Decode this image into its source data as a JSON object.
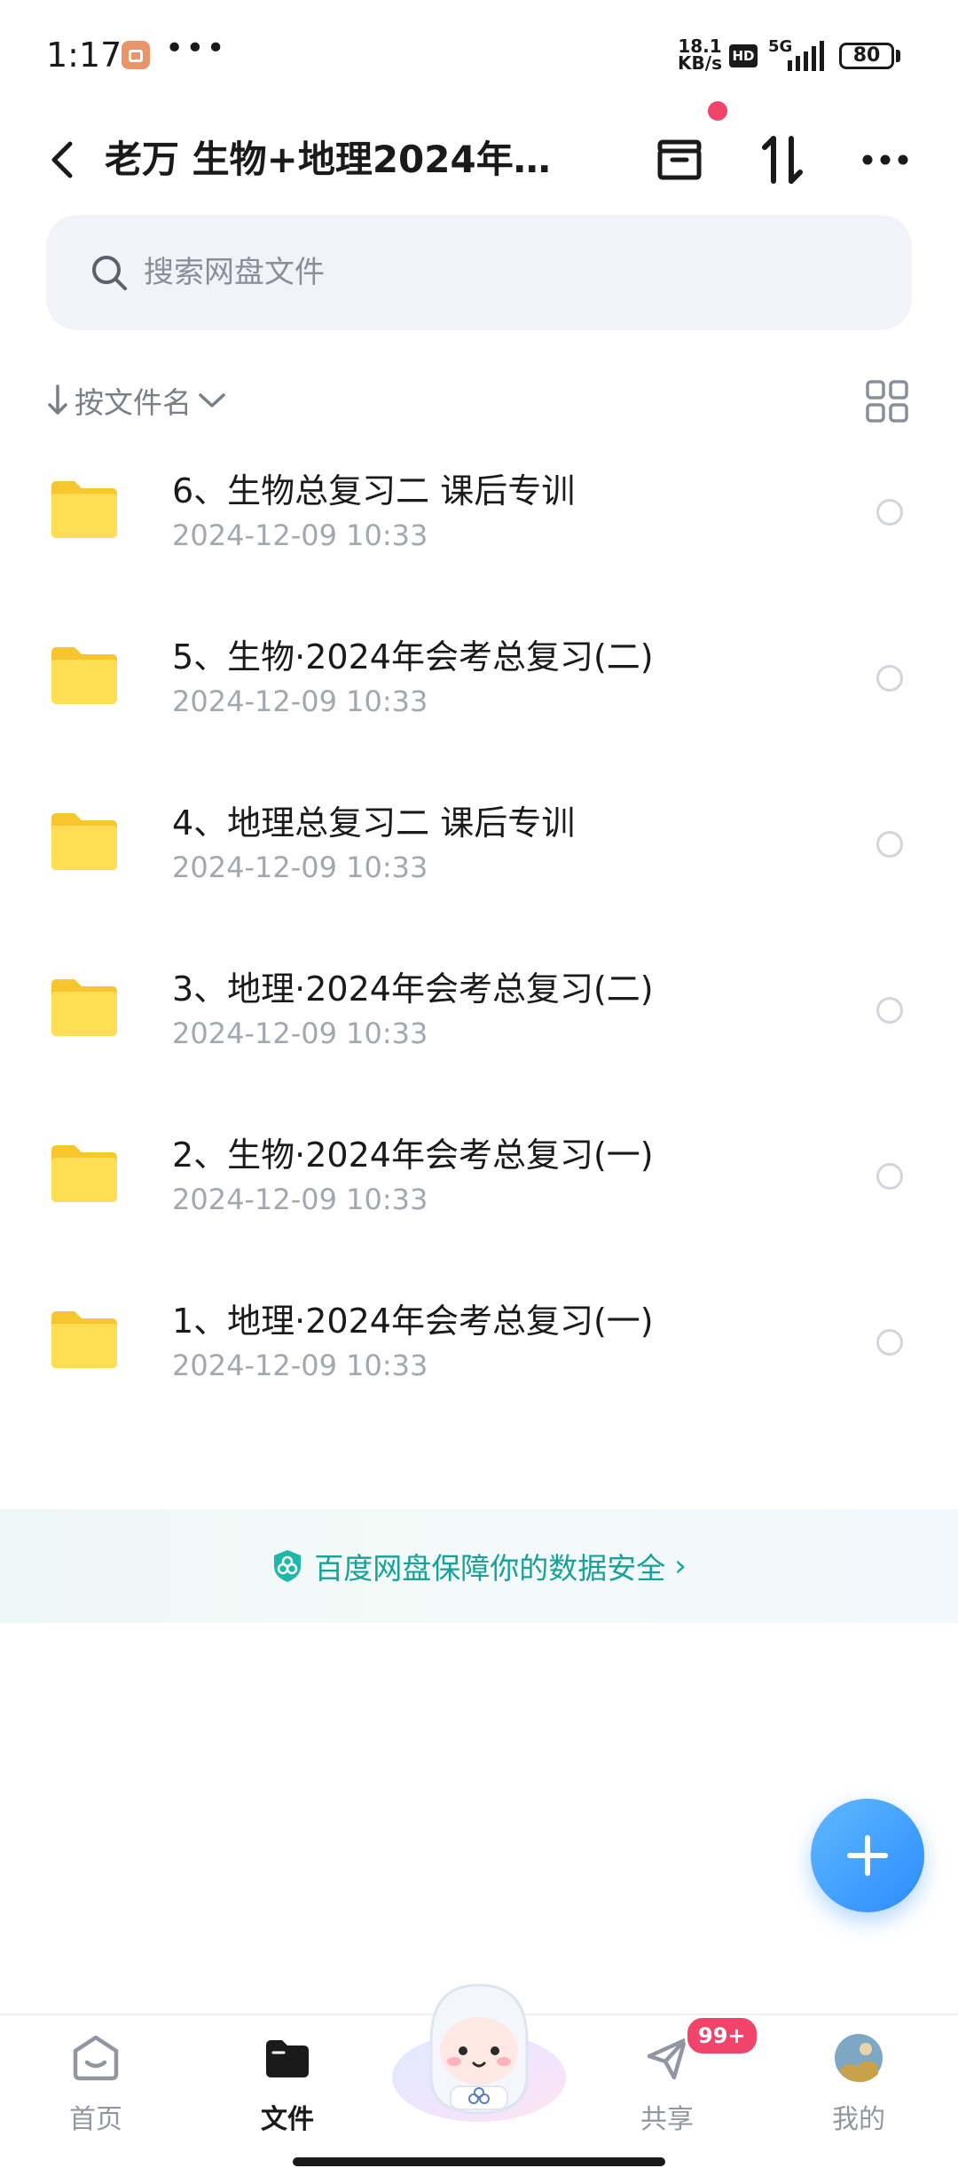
{
  "status_bar": {
    "time": "1:17",
    "more_dots": "•••",
    "net_speed_value": "18.1",
    "net_speed_unit": "KB/s",
    "hd_label": "HD",
    "network_label": "5G",
    "battery_level": "80"
  },
  "header": {
    "title": "老万 生物+地理2024年…",
    "has_notification_dot": true
  },
  "search": {
    "placeholder": "搜索网盘文件"
  },
  "sort": {
    "label": "按文件名"
  },
  "files": [
    {
      "name": "6、生物总复习二 课后专训",
      "modified": "2024-12-09  10:33",
      "type": "folder"
    },
    {
      "name": "5、生物·2024年会考总复习(二)",
      "modified": "2024-12-09  10:33",
      "type": "folder"
    },
    {
      "name": "4、地理总复习二 课后专训",
      "modified": "2024-12-09  10:33",
      "type": "folder"
    },
    {
      "name": "3、地理·2024年会考总复习(二)",
      "modified": "2024-12-09  10:33",
      "type": "folder"
    },
    {
      "name": "2、生物·2024年会考总复习(一)",
      "modified": "2024-12-09  10:33",
      "type": "folder"
    },
    {
      "name": "1、地理·2024年会考总复习(一)",
      "modified": "2024-12-09  10:33",
      "type": "folder"
    }
  ],
  "security_banner": {
    "text": "百度网盘保障你的数据安全",
    "chevron": "›"
  },
  "tab_bar": {
    "tabs": [
      {
        "label": "首页",
        "icon": "home-icon",
        "active": false
      },
      {
        "label": "文件",
        "icon": "folder-icon",
        "active": true
      },
      {
        "label": "共享",
        "icon": "share-icon",
        "active": false
      },
      {
        "label": "我的",
        "icon": "avatar-icon",
        "active": false
      }
    ],
    "share_badge": "99+"
  },
  "colors": {
    "accent": "#2c8bff",
    "security_teal": "#17a197",
    "badge_red": "#f0446a",
    "folder_yellow": "#ffd84a"
  }
}
